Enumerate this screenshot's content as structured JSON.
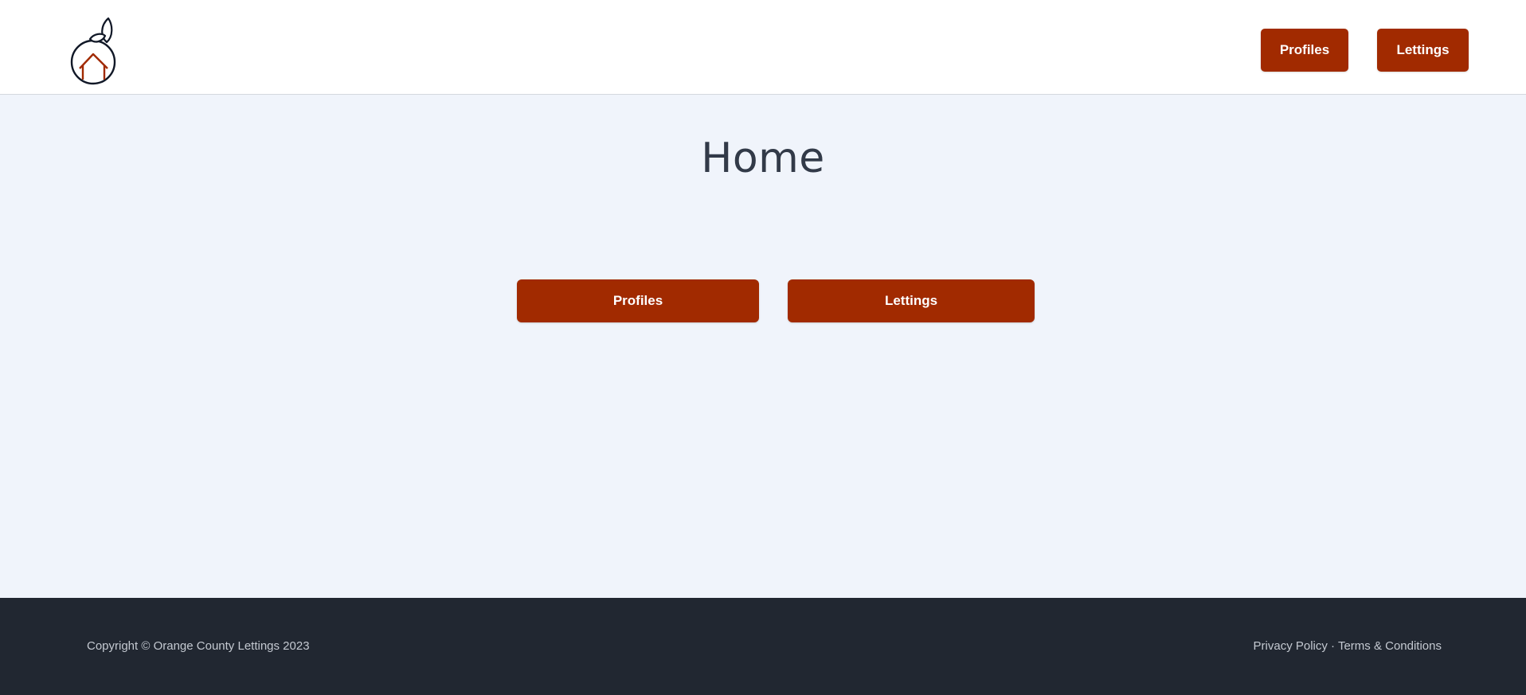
{
  "header": {
    "logo_icon": "orange-house-logo-icon",
    "nav": {
      "profiles_label": "Profiles",
      "lettings_label": "Lettings"
    }
  },
  "main": {
    "title": "Home",
    "buttons": {
      "profiles_label": "Profiles",
      "lettings_label": "Lettings"
    }
  },
  "footer": {
    "copyright": "Copyright © Orange County Lettings 2023",
    "privacy_label": "Privacy Policy",
    "separator": " · ",
    "terms_label": "Terms & Conditions"
  },
  "colors": {
    "accent": "#a12a00",
    "header_bg": "#ffffff",
    "page_bg": "#f0f4fb",
    "footer_bg": "#212731",
    "title_text": "#323a48",
    "footer_text": "#c4c9d1"
  }
}
